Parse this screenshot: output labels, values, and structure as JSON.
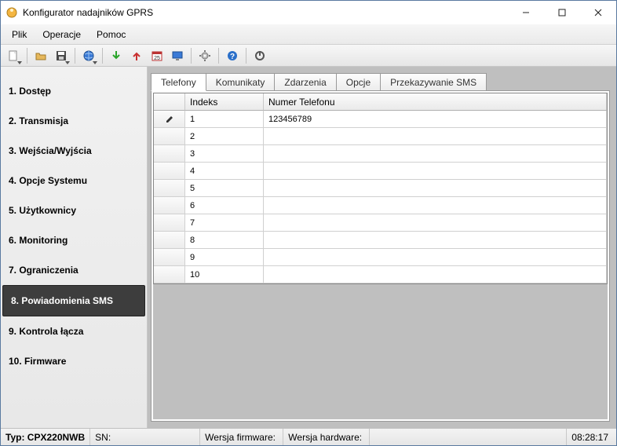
{
  "window": {
    "title": "Konfigurator nadajników GPRS"
  },
  "menu": {
    "file": "Plik",
    "operations": "Operacje",
    "help": "Pomoc"
  },
  "sidebar": {
    "items": [
      {
        "label": "1. Dostęp"
      },
      {
        "label": "2. Transmisja"
      },
      {
        "label": "3. Wejścia/Wyjścia"
      },
      {
        "label": "4. Opcje Systemu"
      },
      {
        "label": "5. Użytkownicy"
      },
      {
        "label": "6. Monitoring"
      },
      {
        "label": "7. Ograniczenia"
      },
      {
        "label": "8. Powiadomienia SMS"
      },
      {
        "label": "9. Kontrola łącza"
      },
      {
        "label": "10. Firmware"
      }
    ],
    "activeIndex": 7
  },
  "tabs": {
    "items": [
      {
        "label": "Telefony"
      },
      {
        "label": "Komunikaty"
      },
      {
        "label": "Zdarzenia"
      },
      {
        "label": "Opcje"
      },
      {
        "label": "Przekazywanie SMS"
      }
    ],
    "activeIndex": 0
  },
  "grid": {
    "headers": {
      "index": "Indeks",
      "number": "Numer Telefonu"
    },
    "rows": [
      {
        "marker": "✎",
        "index": "1",
        "number": "123456789"
      },
      {
        "marker": "",
        "index": "2",
        "number": ""
      },
      {
        "marker": "",
        "index": "3",
        "number": ""
      },
      {
        "marker": "",
        "index": "4",
        "number": ""
      },
      {
        "marker": "",
        "index": "5",
        "number": ""
      },
      {
        "marker": "",
        "index": "6",
        "number": ""
      },
      {
        "marker": "",
        "index": "7",
        "number": ""
      },
      {
        "marker": "",
        "index": "8",
        "number": ""
      },
      {
        "marker": "",
        "index": "9",
        "number": ""
      },
      {
        "marker": "",
        "index": "10",
        "number": ""
      }
    ]
  },
  "status": {
    "type_label": "Typ:",
    "type_value": "CPX220NWB",
    "sn_label": "SN:",
    "sn_value": "",
    "fw_label": "Wersja firmware:",
    "fw_value": "",
    "hw_label": "Wersja hardware:",
    "hw_value": "",
    "clock": "08:28:17"
  },
  "icons": {
    "new": "new-file-icon",
    "open": "open-folder-icon",
    "save": "save-icon",
    "globe": "globe-icon",
    "download": "download-icon",
    "upload": "upload-icon",
    "calendar": "calendar-icon",
    "monitor": "monitor-icon",
    "gear": "gear-icon",
    "help": "help-icon",
    "power": "power-icon"
  }
}
